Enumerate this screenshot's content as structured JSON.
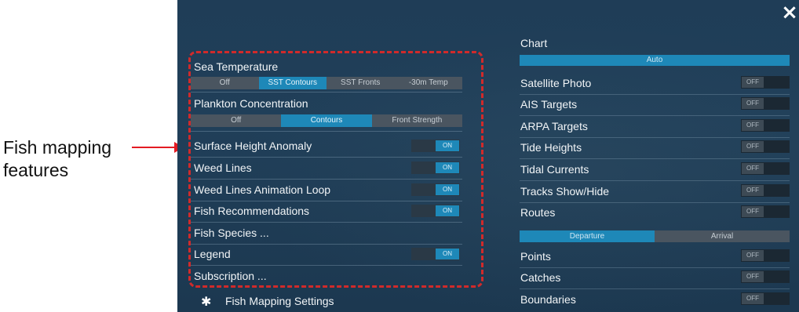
{
  "callout": {
    "line1": "Fish mapping",
    "line2": "features"
  },
  "close_icon": "×",
  "left": {
    "sea_temp": {
      "label": "Sea Temperature",
      "options": [
        "Off",
        "SST Contours",
        "SST Fronts",
        "-30m Temp"
      ],
      "selected": 1
    },
    "plankton": {
      "label": "Plankton Concentration",
      "options": [
        "Off",
        "Contours",
        "Front Strength"
      ],
      "selected": 1
    },
    "rows": [
      {
        "label": "Surface Height Anomaly",
        "toggle": "ON"
      },
      {
        "label": "Weed Lines",
        "toggle": "ON"
      },
      {
        "label": "Weed Lines Animation Loop",
        "toggle": "ON"
      },
      {
        "label": "Fish Recommendations",
        "toggle": "ON"
      },
      {
        "label": "Fish Species ...",
        "toggle": ""
      },
      {
        "label": "Legend",
        "toggle": "ON"
      },
      {
        "label": "Subscription ...",
        "toggle": ""
      }
    ],
    "settings_label": "Fish Mapping Settings",
    "settings_icon": "gear-icon"
  },
  "right": {
    "chart_label": "Chart",
    "chart_value": "Auto",
    "rows": [
      {
        "label": "Satellite Photo",
        "toggle": "OFF"
      },
      {
        "label": "AIS Targets",
        "toggle": "OFF"
      },
      {
        "label": "ARPA Targets",
        "toggle": "OFF"
      },
      {
        "label": "Tide Heights",
        "toggle": "OFF"
      },
      {
        "label": "Tidal Currents",
        "toggle": "OFF"
      },
      {
        "label": "Tracks Show/Hide",
        "toggle": "OFF"
      },
      {
        "label": "Routes",
        "toggle": "OFF"
      }
    ],
    "routes_options": [
      "Departure",
      "Arrival"
    ],
    "routes_selected": 0,
    "rows2": [
      {
        "label": "Points",
        "toggle": "OFF"
      },
      {
        "label": "Catches",
        "toggle": "OFF"
      },
      {
        "label": "Boundaries",
        "toggle": "OFF"
      }
    ]
  },
  "colors": {
    "accent": "#1e88b8",
    "callout_red": "#e31b23",
    "panel_bg": "#1f3d57"
  }
}
